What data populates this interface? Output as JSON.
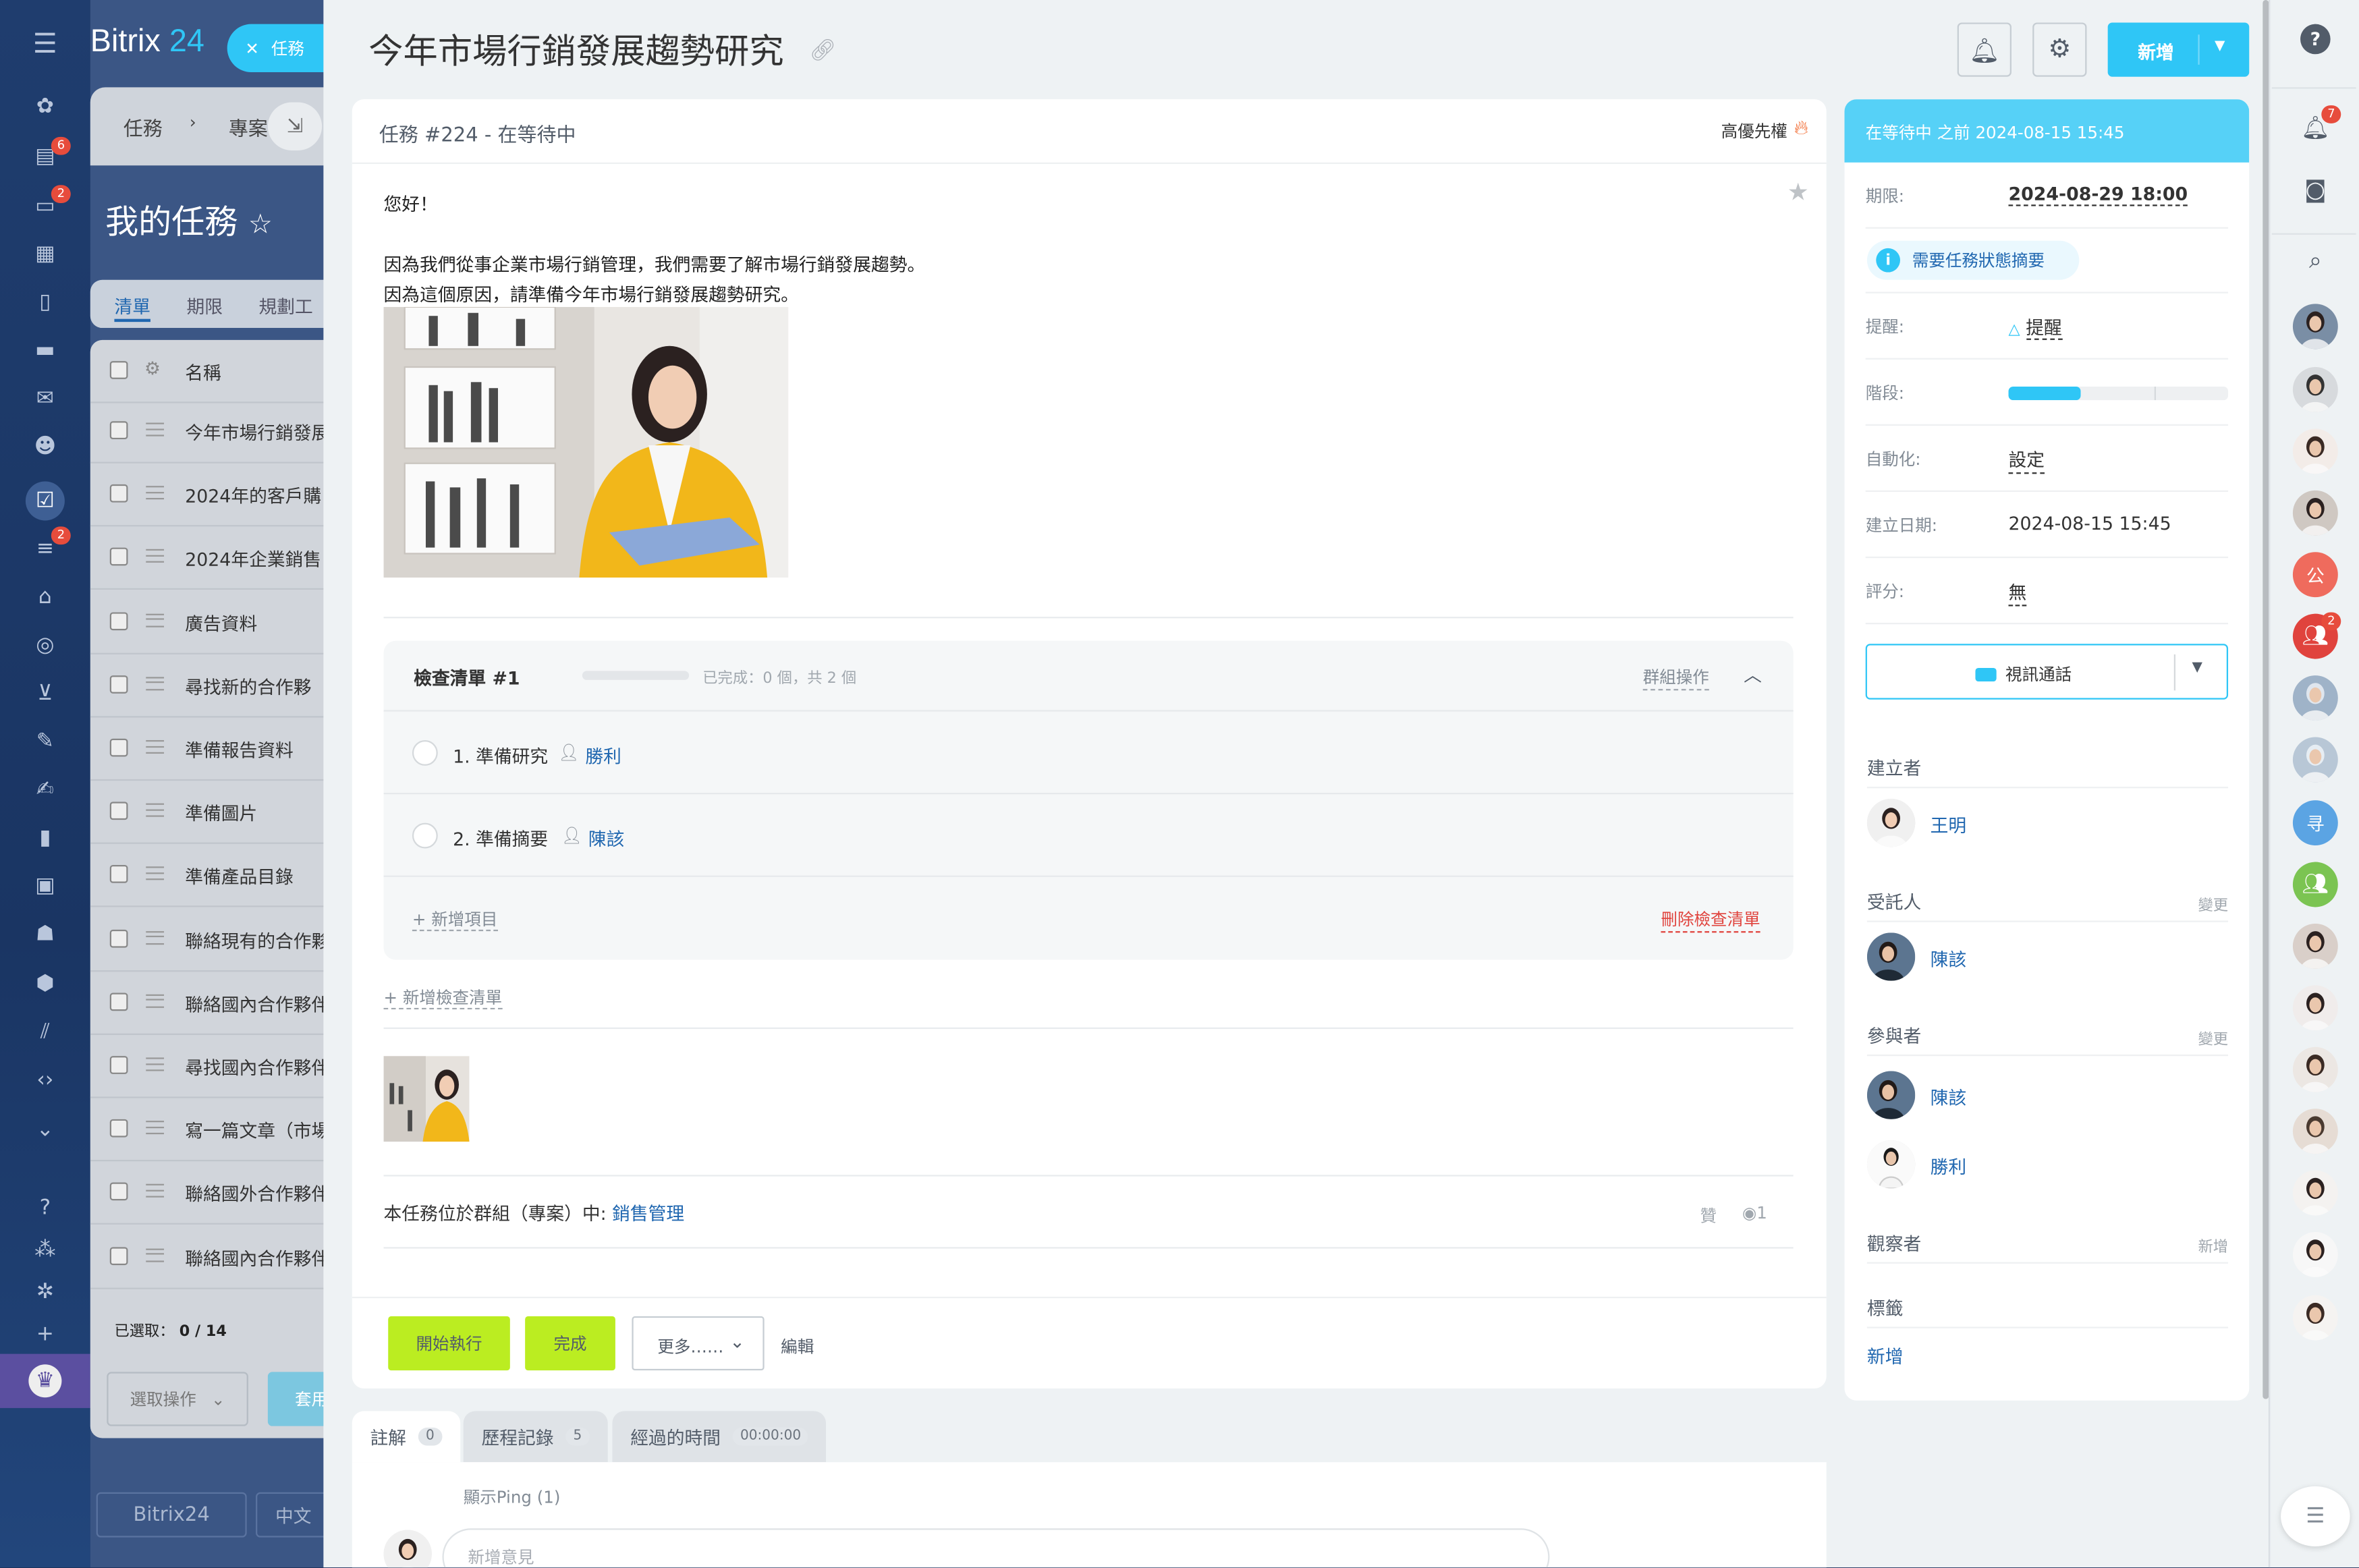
{
  "app": {
    "logo_text": "Bitrix",
    "logo_suffix": "24",
    "task_pill_label": "任務",
    "left_badges": {
      "feed": "6",
      "chat": "2",
      "crm": "2"
    }
  },
  "background_list": {
    "crumbs": [
      "任務",
      "專案"
    ],
    "title": "我的任務",
    "tabs": [
      "清單",
      "期限",
      "規劃工"
    ],
    "column_name": "名稱",
    "rows": [
      "今年市場行銷發展",
      "2024年的客戶購",
      "2024年企業銷售",
      "廣告資料",
      "尋找新的合作夥",
      "準備報告資料",
      "準備圖片",
      "準備產品目錄",
      "聯絡現有的合作夥",
      "聯絡國內合作夥伴",
      "尋找國內合作夥伴",
      "寫一篇文章（市場",
      "聯絡國外合作夥伴",
      "聯絡國內合作夥伴"
    ],
    "selected_label": "已選取：",
    "selected_value": "0 / 14",
    "select_action": "選取操作",
    "apply_label": "套用",
    "bottom_brand": "Bitrix24",
    "lang_label": "中文"
  },
  "header": {
    "title": "今年市場行銷發展趨勢研究",
    "add_label": "新增"
  },
  "task": {
    "heading": "任務 #224 - 在等待中",
    "priority": "高優先權",
    "description": [
      "您好！",
      "",
      "因為我們從事企業市場行銷管理，我們需要了解市場行銷發展趨勢。",
      "因為這個原因，請準備今年市場行銷發展趨勢研究。"
    ],
    "checklist": {
      "title": "檢查清單 #1",
      "done_text": "已完成：0 個，共 2 個",
      "group_action": "群組操作",
      "items": [
        {
          "text": "1. 準備研究",
          "user": "勝利"
        },
        {
          "text": "2. 準備摘要",
          "user": "陳該"
        }
      ],
      "add_item": "+ 新增項目",
      "delete": "刪除檢查清單"
    },
    "add_checklist": "+ 新增檢查清單",
    "group_prefix": "本任務位於群組（專案）中:",
    "group_name": "銷售管理",
    "like": "贊",
    "views": "1"
  },
  "actions": {
    "start": "開始執行",
    "complete": "完成",
    "more": "更多……",
    "edit": "編輯"
  },
  "tabs": [
    {
      "label": "註解",
      "count": "0"
    },
    {
      "label": "歷程記錄",
      "count": "5"
    },
    {
      "label": "經過的時間",
      "count": "00:00:00"
    }
  ],
  "comments": {
    "ping": "顯示Ping (1)",
    "placeholder": "新增意見"
  },
  "sidebar": {
    "status_head": "在等待中 之前 2024-08-15 15:45",
    "deadline_label": "期限:",
    "deadline_value": "2024-08-29 18:00",
    "summary_pill": "需要任務狀態摘要",
    "reminder_label": "提醒:",
    "reminder_value": "提醒",
    "stage_label": "階段:",
    "stage_progress": 0.33,
    "automation_label": "自動化:",
    "automation_value": "設定",
    "created_label": "建立日期:",
    "created_value": "2024-08-15 15:45",
    "rating_label": "評分:",
    "rating_value": "無",
    "video_call": "視訊通話",
    "creator_title": "建立者",
    "creator": "王明",
    "assignee_title": "受託人",
    "assignee_change": "變更",
    "assignee": "陳該",
    "participants_title": "參與者",
    "participants_change": "變更",
    "participants": [
      "陳該",
      "勝利"
    ],
    "observers_title": "觀察者",
    "observers_add": "新增",
    "tags_title": "標籤",
    "tags_add": "新增"
  },
  "rail": {
    "notify_badge": "7",
    "group_badge": "2",
    "avatar_letters": [
      "公",
      "寻"
    ]
  },
  "colors": {
    "accent": "#2fc6f6",
    "green": "#bbed21",
    "link": "#2067b0",
    "danger": "#e0433d"
  }
}
